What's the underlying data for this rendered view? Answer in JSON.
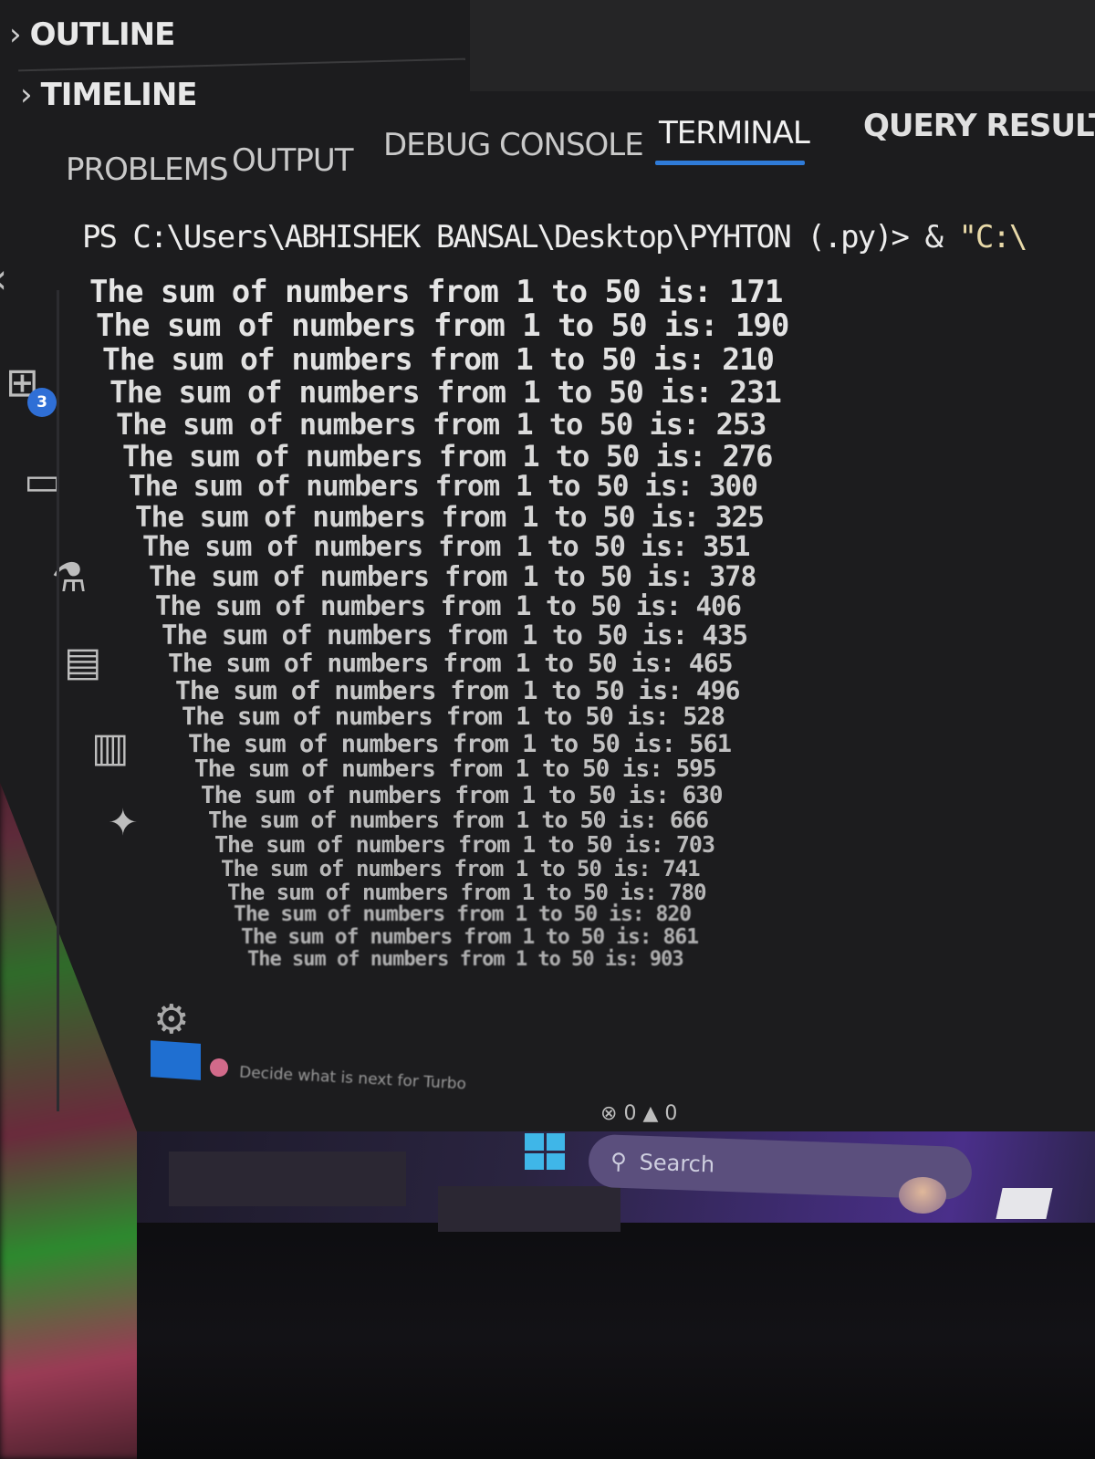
{
  "side_panel": {
    "sections": [
      {
        "label": "OUTLINE"
      },
      {
        "label": "TIMELINE"
      }
    ]
  },
  "panel": {
    "tabs": [
      {
        "label": "PROBLEMS",
        "active": false
      },
      {
        "label": "OUTPUT",
        "active": false
      },
      {
        "label": "DEBUG CONSOLE",
        "active": false
      },
      {
        "label": "TERMINAL",
        "active": true
      },
      {
        "label": "QUERY RESULT",
        "active": false
      }
    ],
    "accent_color": "#2f7bd8"
  },
  "activity_bar": {
    "extensions_badge": "3",
    "icons": [
      "extensions-icon",
      "remote-explorer-icon",
      "testing-icon",
      "database-icon",
      "notebook-icon",
      "copilot-icon",
      "settings-gear-icon",
      "account-icon"
    ]
  },
  "terminal": {
    "prompt": "PS C:\\Users\\ABHISHEK BANSAL\\Desktop\\PYHTON (.py)>",
    "command_amp": " & ",
    "command_str": "\"C:\\",
    "lines": [
      "The sum of numbers from 1 to 50 is: 171",
      "The sum of numbers from 1 to 50 is: 190",
      "The sum of numbers from 1 to 50 is: 210",
      "The sum of numbers from 1 to 50 is: 231",
      "The sum of numbers from 1 to 50 is: 253",
      "The sum of numbers from 1 to 50 is: 276",
      "The sum of numbers from 1 to 50 is: 300",
      "The sum of numbers from 1 to 50 is: 325",
      "The sum of numbers from 1 to 50 is: 351",
      "The sum of numbers from 1 to 50 is: 378",
      "The sum of numbers from 1 to 50 is: 406",
      "The sum of numbers from 1 to 50 is: 435",
      "The sum of numbers from 1 to 50 is: 465",
      "The sum of numbers from 1 to 50 is: 496",
      "The sum of numbers from 1 to 50 is: 528",
      "The sum of numbers from 1 to 50 is: 561",
      "The sum of numbers from 1 to 50 is: 595",
      "The sum of numbers from 1 to 50 is: 630",
      "The sum of numbers from 1 to 50 is: 666",
      "The sum of numbers from 1 to 50 is: 703",
      "The sum of numbers from 1 to 50 is: 741",
      "The sum of numbers from 1 to 50 is: 780",
      "The sum of numbers from 1 to 50 is: 820",
      "The sum of numbers from 1 to 50 is: 861",
      "The sum of numbers from 1 to 50 is: 903"
    ]
  },
  "status_bar": {
    "message": "Decide what is next for Turbo",
    "errors": "0",
    "warnings": "0",
    "error_icon": "error-circle-icon",
    "warning_icon": "warning-triangle-icon"
  },
  "taskbar": {
    "search_placeholder": "Search",
    "start_icon": "windows-start-icon"
  }
}
